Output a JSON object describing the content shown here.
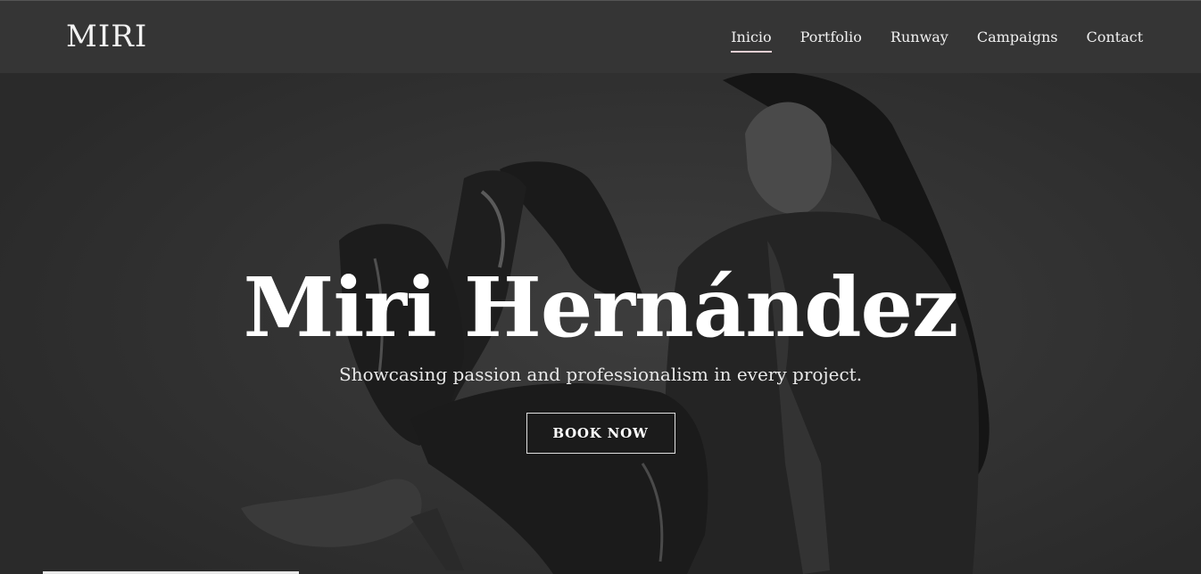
{
  "header": {
    "logo": "MIRI",
    "nav": [
      {
        "label": "Inicio",
        "active": true
      },
      {
        "label": "Portfolio",
        "active": false
      },
      {
        "label": "Runway",
        "active": false
      },
      {
        "label": "Campaigns",
        "active": false
      },
      {
        "label": "Contact",
        "active": false
      }
    ]
  },
  "hero": {
    "title": "Miri Hernández",
    "subtitle": "Showcasing passion and professionalism in every project.",
    "cta_label": "BOOK NOW"
  },
  "colors": {
    "background": "#2e2e2e",
    "navbar": "#353535",
    "text": "#ffffff",
    "nav_active_underline": "#e3cfd3"
  }
}
